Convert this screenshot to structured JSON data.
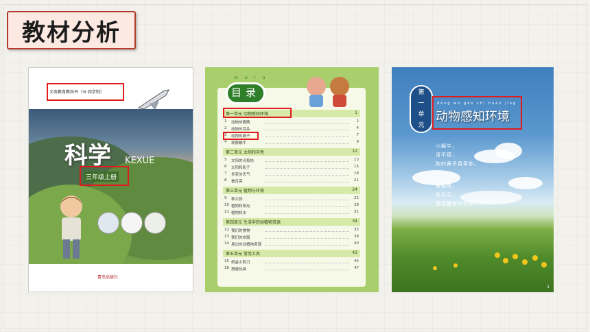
{
  "title": "教材分析",
  "book1": {
    "series_label": "义务教育教科书（五·四学制）",
    "title_cn": "科学",
    "title_pinyin": "KEXUE",
    "grade": "三年级上册",
    "publisher": "青岛出版社"
  },
  "book2": {
    "toc_heading": "目录",
    "toc_heading_pinyin": [
      "mù",
      "lù"
    ],
    "units": [
      {
        "title": "第一单元  动物感知环境",
        "page": "1",
        "lessons": [
          {
            "n": "1",
            "t": "动物的眼睛",
            "p": "2"
          },
          {
            "n": "2",
            "t": "动物的耳朵",
            "p": "4"
          },
          {
            "n": "3",
            "t": "动物的鼻子",
            "p": "7"
          },
          {
            "n": "4",
            "t": "观察蜗牛",
            "p": "9"
          }
        ]
      },
      {
        "title": "第二单元  太阳和月亮",
        "page": "12",
        "lessons": [
          {
            "n": "5",
            "t": "太阳的光和热",
            "p": "13"
          },
          {
            "n": "6",
            "t": "太阳和影子",
            "p": "15"
          },
          {
            "n": "7",
            "t": "多变的天气",
            "p": "18"
          },
          {
            "n": "8",
            "t": "看月亮",
            "p": "21"
          }
        ]
      },
      {
        "title": "第三单元  植物与环境",
        "page": "24",
        "lessons": [
          {
            "n": "9",
            "t": "种大蒜",
            "p": "25"
          },
          {
            "n": "10",
            "t": "植物和阳光",
            "p": "28"
          },
          {
            "n": "11",
            "t": "植物和水",
            "p": "31"
          }
        ]
      },
      {
        "title": "第四单元  生活中的动植物资源",
        "page": "34",
        "lessons": [
          {
            "n": "12",
            "t": "我们的食物",
            "p": "35"
          },
          {
            "n": "13",
            "t": "我们的衣服",
            "p": "38"
          },
          {
            "n": "14",
            "t": "身边的动植物资源",
            "p": "40"
          }
        ]
      },
      {
        "title": "第五单元  常用工具",
        "page": "43",
        "lessons": [
          {
            "n": "15",
            "t": "纸盒小剪刀",
            "p": "44"
          },
          {
            "n": "16",
            "t": "搭建玩具",
            "p": "47"
          }
        ]
      }
    ]
  },
  "book3": {
    "unit_label": [
      "第",
      "一",
      "单",
      "元"
    ],
    "unit_title": "动物感知环境",
    "unit_title_pinyin": "dòng wù gǎn zhī huán jìng",
    "poem": [
      "小蜗牛，",
      "请不慌，",
      "狗的鼻子真奇妙。",
      "蝙蝠哥，",
      "兔耳朵，",
      "感觉器官本领多。"
    ],
    "page_no": "1"
  },
  "colors": {
    "accent_red": "#e01b1b",
    "title_border": "#b23a2e",
    "toc_green": "#a9cf6c"
  }
}
